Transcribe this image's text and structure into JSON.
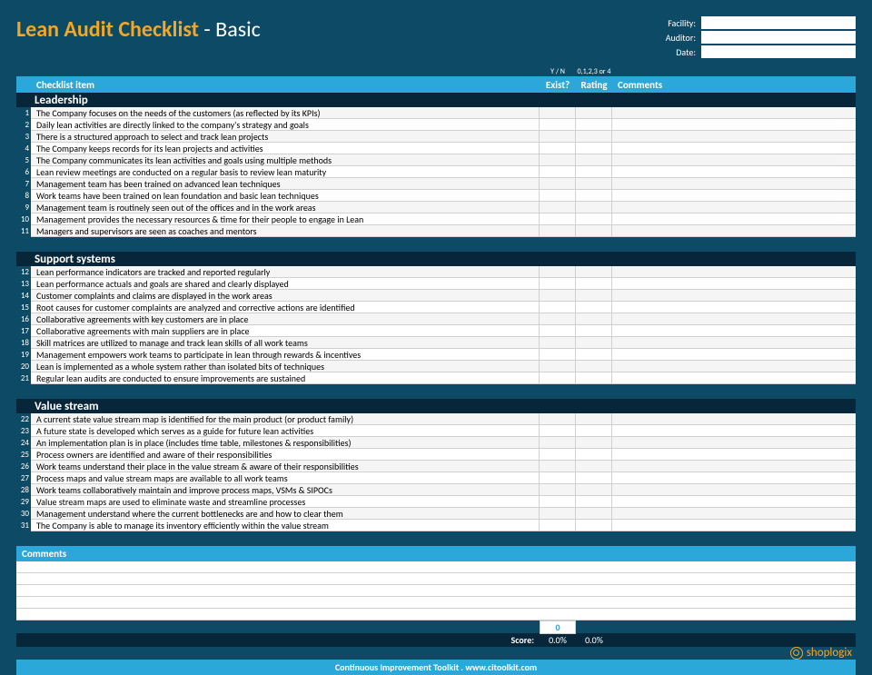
{
  "title_main": "Lean Audit Checklist",
  "title_sep": " - ",
  "title_sub": "Basic",
  "meta": {
    "facility_label": "Facility:",
    "auditor_label": "Auditor:",
    "date_label": "Date:",
    "facility": "",
    "auditor": "",
    "date": ""
  },
  "col_hints": {
    "yn": "Y / N",
    "scale": "0,1,2,3 or 4"
  },
  "columns": {
    "item": "Checklist item",
    "exist": "Exist?",
    "rating": "Rating",
    "comments": "Comments"
  },
  "sections": [
    {
      "name": "Leadership",
      "start": 1,
      "items": [
        "The Company focuses on the needs of the customers (as reflected by its KPIs)",
        "Daily lean activities are directly linked to the company's strategy and goals",
        "There is a structured approach to select and track lean projects",
        "The Company keeps records for its lean projects and activities",
        "The Company communicates its lean activities and goals using multiple methods",
        "Lean review meetings are conducted on a regular basis to review lean maturity",
        "Management team has been trained on advanced lean techniques",
        "Work teams have been trained on lean foundation and basic lean techniques",
        "Management team is routinely seen out of the offices and in the work areas",
        "Management provides the necessary resources & time for their people to engage in Lean",
        "Managers and supervisors are seen as  coaches and mentors"
      ]
    },
    {
      "name": "Support systems",
      "start": 12,
      "items": [
        "Lean performance indicators are tracked and reported regularly",
        "Lean performance actuals and goals are shared and clearly displayed",
        "Customer complaints and claims are displayed in the work areas",
        "Root causes for customer complaints are analyzed and corrective actions are identified",
        "Collaborative agreements with key customers are in place",
        "Collaborative agreements with main suppliers are in place",
        "Skill matrices are utilized to manage and track lean skills of all work teams",
        "Management empowers work teams to participate in lean through rewards & incentives",
        "Lean is implemented as a whole system rather than isolated bits of techniques",
        "Regular lean audits are conducted to ensure improvements are sustained"
      ]
    },
    {
      "name": "Value stream",
      "start": 22,
      "items": [
        "A current state value stream map is identified for the main product (or product family)",
        "A future state is developed which serves as a guide for future lean activities",
        "An implementation plan is in place (includes time table, milestones & responsibilities)",
        "Process owners are identified and aware of their responsibilities",
        "Work teams understand their place in the value stream & aware of their responsibilities",
        "Process maps and value stream maps are available to all work teams",
        "Work teams collaboratively maintain and improve process maps, VSMs & SIPOCs",
        "Value stream maps are used to eliminate waste and streamline processes",
        "Management understand where the current bottlenecks are and how to clear them",
        "The Company is able to manage its inventory efficiently within the value stream"
      ]
    }
  ],
  "comments_header": "Comments",
  "comment_lines": 5,
  "totals": {
    "zero": "0"
  },
  "score": {
    "label": "Score:",
    "exist_pct": "0.0%",
    "rating_pct": "0.0%"
  },
  "footer": "Continuous Improvement Toolkit . www.citoolkit.com",
  "brand": "shoplogix"
}
